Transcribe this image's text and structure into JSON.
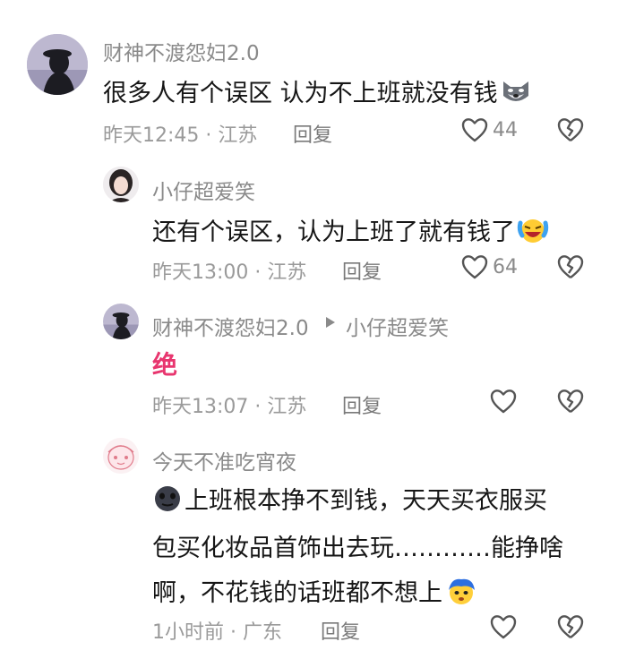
{
  "comments": [
    {
      "author": "财神不渡怨妇2.0",
      "text": "很多人有个误区 认为不上班就没有钱",
      "time_loc": "昨天12:45 · 江苏",
      "reply_label": "回复",
      "likes": "44",
      "emoji_end": "wolf-face-emoji"
    },
    {
      "author": "小仔超爱笑",
      "text": "还有个误区，认为上班了就有钱了",
      "time_loc": "昨天13:00 · 江苏",
      "reply_label": "回复",
      "likes": "64",
      "emoji_end": "laughing-crying-emoji"
    },
    {
      "author": "财神不渡怨妇2.0",
      "reply_to": "小仔超爱笑",
      "text": "绝",
      "text_color": "#e8366f",
      "time_loc": "昨天13:07 · 江苏",
      "reply_label": "回复",
      "likes": ""
    },
    {
      "author": "今天不准吃宵夜",
      "text_lines": [
        "上班根本挣不到钱，天天买衣服买",
        "包买化妆品首饰出去玩…………能挣啥",
        "啊，不花钱的话班都不想上"
      ],
      "time_loc": "1小时前 · 广东",
      "reply_label": "回复",
      "likes": "",
      "emoji_start": "dark-face-emoji",
      "emoji_end": "blue-hair-face-emoji"
    }
  ]
}
